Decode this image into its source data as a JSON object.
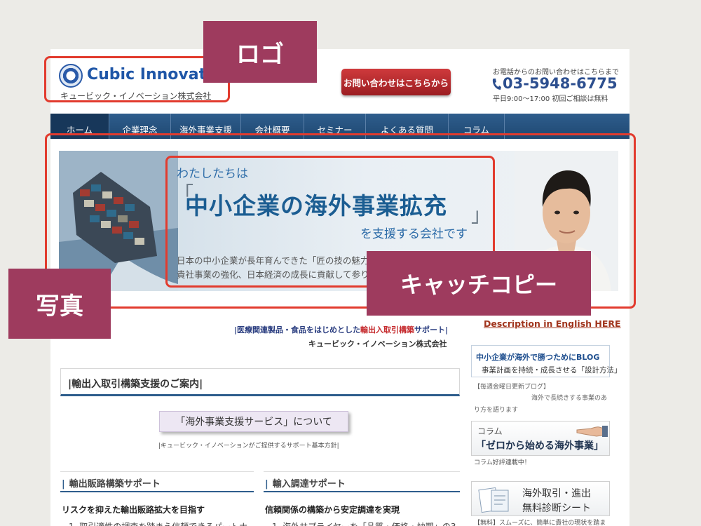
{
  "header": {
    "logo_name": "Cubic Innovation",
    "logo_subtitle": "キュービック・イノベーション株式会社",
    "contact_button": "お問い合わせはこちらから",
    "phone_label": "お電話からのお問い合わせはこちらまで",
    "phone_number": "03-5948-6775",
    "phone_hours": "平日9:00〜17:00 初回ご相談は無料"
  },
  "nav": {
    "items": [
      {
        "label": "ホーム"
      },
      {
        "label": "企業理念"
      },
      {
        "label": "海外事業支援"
      },
      {
        "label": "会社概要"
      },
      {
        "label": "セミナー"
      },
      {
        "label": "よくある質問"
      },
      {
        "label": "コラム"
      }
    ]
  },
  "hero": {
    "lead": "わたしたちは",
    "bracket_open": "「",
    "main": "中小企業の海外事業拡充",
    "bracket_close": "」",
    "tail": "を支援する会社です",
    "desc_line1": "日本の中小企業が長年育んできた「匠の技の魅力」を海外消費者へ伝え",
    "desc_line2": "貴社事業の強化、日本経済の成長に貢献して参ります。"
  },
  "main": {
    "tagline_pre": "|医療関連製品・食品をはじめとした",
    "tagline_hl": "輸出入取引構築",
    "tagline_post": "サポート|",
    "company_line": "キュービック・イノベーション株式会社",
    "section_title": "|輸出入取引構築支援のご案内|",
    "service_title": "「海外事業支援サービス」について",
    "service_caption": "|キュービック・イノベーションがご提供するサポート基本方針|",
    "left_col_title": "輸出販路構築サポート",
    "left_col_sub": "リスクを抑えた輸出販路拡大を目指す",
    "left_col_cut": "1. 取引適性の調査を踏まえ信頼できるパートナ",
    "right_col_title": "輸入調達サポート",
    "right_col_sub": "信頼関係の構築から安定調達を実現",
    "right_col_cut": "1. 海外サプライヤーを「品質・価格・納期」の3"
  },
  "sidebar": {
    "description_en": "Description in English HERE",
    "blog_title": "中小企業が海外で勝つためにBLOG",
    "blog_sub": "事業計画を持続・成長させる「設計方法」",
    "blog_note1": "【毎週金曜日更新ブログ】",
    "blog_note2": "海外で長続きする事業のあ",
    "blog_note3": "り方を語ります",
    "column_label": "コラム",
    "column_title": "「ゼロから始める海外事業」",
    "column_note": "コラム好評連載中！",
    "diag_title1": "海外取引・進出",
    "diag_title2": "無料診断シート",
    "diag_note": "【無料】スムーズに、簡単に貴社の現状を踏ま"
  },
  "annotations": {
    "logo": "ロゴ",
    "photo": "写真",
    "catch_copy": "キャッチコピー"
  },
  "colors": {
    "nav": "#2e5d8c",
    "accent_red": "#e23b2e",
    "label_bg": "#9e3b5e",
    "brand_blue": "#1f56a7"
  }
}
